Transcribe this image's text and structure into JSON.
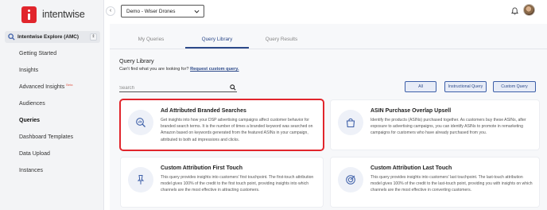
{
  "app": {
    "brand": "intentwise",
    "workspace": "Intentwise Explore (AMC)"
  },
  "sidebar": {
    "items": [
      {
        "label": "Getting Started"
      },
      {
        "label": "Insights"
      },
      {
        "label": "Advanced Insights",
        "badge": "Beta"
      },
      {
        "label": "Audiences"
      },
      {
        "label": "Queries",
        "active": true
      },
      {
        "label": "Dashboard Templates"
      },
      {
        "label": "Data Upload"
      },
      {
        "label": "Instances"
      }
    ]
  },
  "topbar": {
    "account": "Demo - Wiser Drones"
  },
  "tabs": [
    {
      "label": "My Queries"
    },
    {
      "label": "Query Library",
      "active": true
    },
    {
      "label": "Query Results"
    }
  ],
  "library": {
    "title": "Query Library",
    "subtitle": "Can't find what you are looking for?",
    "request_link": "Request custom query.",
    "search_placeholder": "Search",
    "filters": [
      "All",
      "Instructional Query",
      "Custom Query"
    ]
  },
  "cards": [
    {
      "title": "Ad Attributed Branded Searches",
      "description": "Get insights into how your DSP advertising campaigns affect customer behavior for branded search terms. It is the number of times a branded keyword was searched on Amazon based on keywords generated from the featured ASINs in your campaign, attributed to both ad impressions and clicks.",
      "icon": "search-chart-icon",
      "highlighted": true
    },
    {
      "title": "ASIN Purchase Overlap Upsell",
      "description": "Identify the products (ASINs) purchased together. As customers buy these ASINs, after exposure to advertising campaigns, you can identify ASINs to promote in remarketing campaigns for customers who have already purchased from you.",
      "icon": "shopping-bag-icon"
    },
    {
      "title": "Custom Attribution First Touch",
      "description": "This query provides insights into customers' first touchpoint. The first-touch attribution model gives 100% of the credit to the first touch point, providing insights into which channels are the most effective in attracting customers.",
      "icon": "pin-icon"
    },
    {
      "title": "Custom Attribution Last Touch",
      "description": "This query provides insights into customers' last touchpoint. The last-touch attribution model gives 100% of the credit to the last-touch point, providing you with insights on which channels are the most effective in converting customers.",
      "icon": "target-icon"
    }
  ],
  "colors": {
    "brand_red": "#e1252c",
    "accent_blue": "#2d4a8a",
    "sidebar_bg": "#f3f4f6",
    "main_bg": "#f7f8fa"
  }
}
